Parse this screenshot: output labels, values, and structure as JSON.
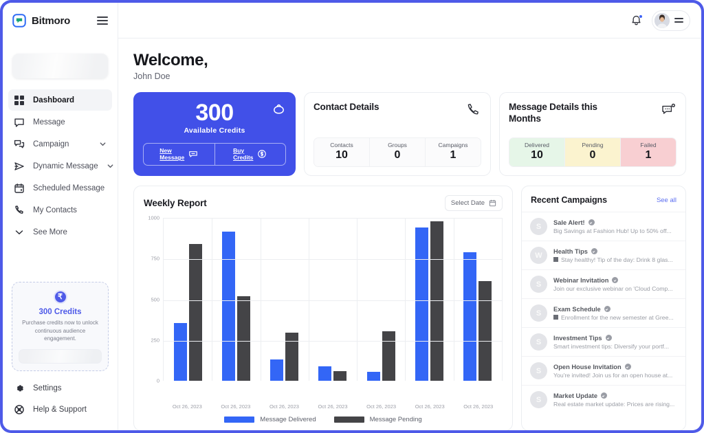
{
  "brand": {
    "name": "Bitmoro",
    "logo_icon": "bitmoro-logo-icon",
    "menu_icon": "hamburger-icon"
  },
  "sidebar": {
    "items": [
      {
        "label": "Dashboard",
        "icon": "grid-icon",
        "active": true,
        "chevron": false
      },
      {
        "label": "Message",
        "icon": "chat-bubble-icon",
        "active": false,
        "chevron": false
      },
      {
        "label": "Campaign",
        "icon": "campaign-icon",
        "active": false,
        "chevron": true
      },
      {
        "label": "Dynamic Message",
        "icon": "send-icon",
        "active": false,
        "chevron": true
      },
      {
        "label": "Scheduled Message",
        "icon": "calendar-icon",
        "active": false,
        "chevron": false
      },
      {
        "label": "My Contacts",
        "icon": "phone-icon",
        "active": false,
        "chevron": false
      },
      {
        "label": "See More",
        "icon": "chevron-down-icon",
        "active": false,
        "chevron": false
      }
    ],
    "credit_promo": {
      "coin_icon": "rupee-coin-icon",
      "amount": "300 Credits",
      "description": "Purchase credits now to unlock continuous audience engagement."
    },
    "footer_items": [
      {
        "label": "Settings",
        "icon": "gear-icon"
      },
      {
        "label": "Help & Support",
        "icon": "lifebuoy-icon"
      }
    ]
  },
  "topbar": {
    "bell_icon": "bell-icon",
    "avatar_icon": "user-avatar",
    "menu_icon": "hamburger-icon"
  },
  "welcome": {
    "title": "Welcome,",
    "user": "John Doe"
  },
  "credits_card": {
    "amount": "300",
    "label": "Available  Credits",
    "bag_icon": "credit-bag-icon",
    "actions": [
      {
        "line1": "New",
        "line2": "Message",
        "icon": "message-icon"
      },
      {
        "line1": "Buy",
        "line2": "Credits",
        "icon": "dollar-coin-icon"
      }
    ]
  },
  "contact_details": {
    "title": "Contact Details",
    "icon": "phone-icon",
    "cells": [
      {
        "label": "Contacts",
        "value": "10"
      },
      {
        "label": "Groups",
        "value": "0"
      },
      {
        "label": "Campaigns",
        "value": "1"
      }
    ]
  },
  "message_details": {
    "title": "Message Details this Months",
    "icon": "chat-dots-icon",
    "cells": [
      {
        "label": "Delivered",
        "value": "10",
        "bg": "#e6f6e8"
      },
      {
        "label": "Pending",
        "value": "0",
        "bg": "#fbf3cf"
      },
      {
        "label": "Failed",
        "value": "1",
        "bg": "#f8cfd2"
      }
    ]
  },
  "weekly_report": {
    "title": "Weekly Report",
    "date_button": {
      "label": "Select Date",
      "icon": "calendar-icon"
    }
  },
  "chart_data": {
    "type": "bar",
    "title": "Weekly Report",
    "xlabel": "",
    "ylabel": "",
    "ylim": [
      0,
      1000
    ],
    "yticks": [
      0,
      250,
      500,
      750,
      1000
    ],
    "grid": true,
    "legend_position": "bottom",
    "categories": [
      "Oct 26, 2023",
      "Oct 26, 2023",
      "Oct 26, 2023",
      "Oct 26, 2023",
      "Oct 26, 2023",
      "Oct 26, 2023",
      "Oct 26, 2023"
    ],
    "series": [
      {
        "name": "Message Delivered",
        "color": "#3366f6",
        "values": [
          355,
          915,
          130,
          90,
          55,
          940,
          790
        ]
      },
      {
        "name": "Message Pending",
        "color": "#444447",
        "values": [
          840,
          520,
          295,
          60,
          305,
          980,
          610
        ]
      }
    ]
  },
  "recent_campaigns": {
    "title": "Recent Campaigns",
    "see_all": "See all",
    "items": [
      {
        "avatar": "S",
        "name": "Sale Alert!",
        "has_square": false,
        "desc": "Big Savings at Fashion Hub! Up to 50% off..."
      },
      {
        "avatar": "W",
        "name": "Health Tips",
        "has_square": true,
        "desc": "Stay healthy! Tip of the day: Drink 8 glas..."
      },
      {
        "avatar": "S",
        "name": "Webinar Invitation",
        "has_square": false,
        "desc": "Join our exclusive webinar on 'Cloud Comp..."
      },
      {
        "avatar": "S",
        "name": "Exam Schedule",
        "has_square": true,
        "desc": "Enrollment for the new semester at Gree..."
      },
      {
        "avatar": "S",
        "name": "Investment Tips",
        "has_square": false,
        "desc": "Smart investment tips: Diversify your portf..."
      },
      {
        "avatar": "S",
        "name": "Open House Invitation",
        "has_square": false,
        "desc": "You're invited! Join us for an open house at..."
      },
      {
        "avatar": "S",
        "name": "Market Update",
        "has_square": false,
        "desc": "Real estate market update: Prices are rising..."
      }
    ]
  },
  "colors": {
    "brand_blue": "#4150e8",
    "frame_blue": "#4e5ae8",
    "bar_delivered": "#3366f6",
    "bar_pending": "#444447",
    "link_blue": "#5b6ef0"
  }
}
